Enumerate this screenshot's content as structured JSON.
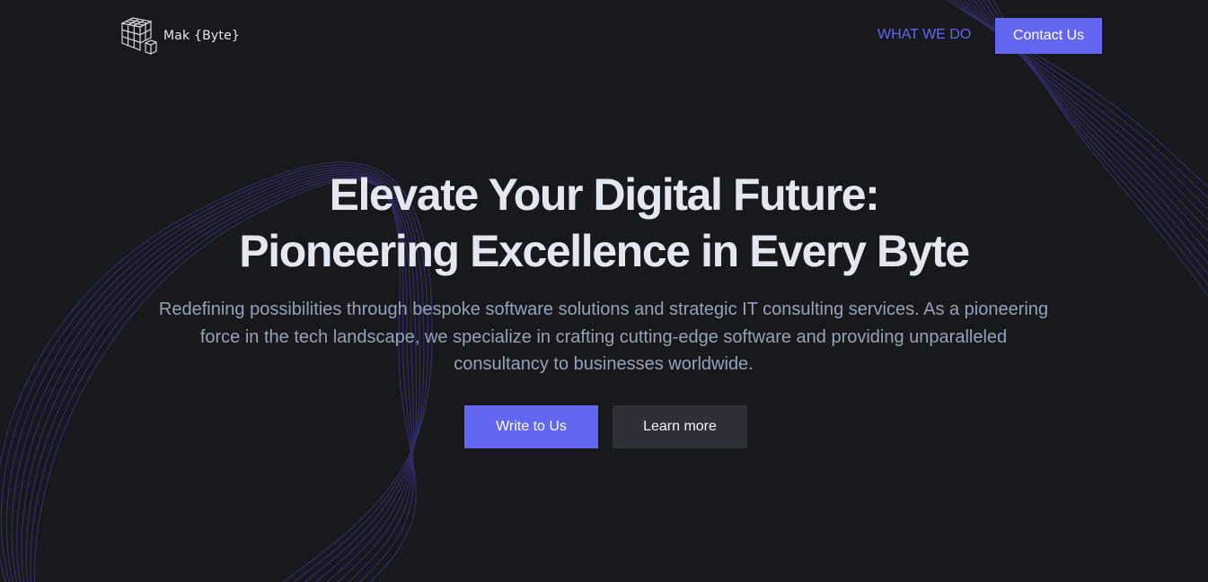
{
  "brand": {
    "name": "Mak {Byte}",
    "accent_color": "#6366f1",
    "background_color": "#18191c"
  },
  "nav": {
    "links": [
      {
        "label": "WHAT WE DO"
      }
    ],
    "cta_label": "Contact Us"
  },
  "hero": {
    "title_line1": "Elevate Your Digital Future:",
    "title_line2": "Pioneering Excellence in Every Byte",
    "subtitle": "Redefining possibilities through bespoke software solutions and strategic IT consulting services. As a pioneering force in the tech landscape, we specialize in crafting cutting-edge software and providing unparalleled consultancy to businesses worldwide.",
    "primary_button": "Write to Us",
    "secondary_button": "Learn more"
  },
  "icons": {
    "logo": "cube-grid-logo-icon",
    "background": "wave-lines-decoration"
  }
}
